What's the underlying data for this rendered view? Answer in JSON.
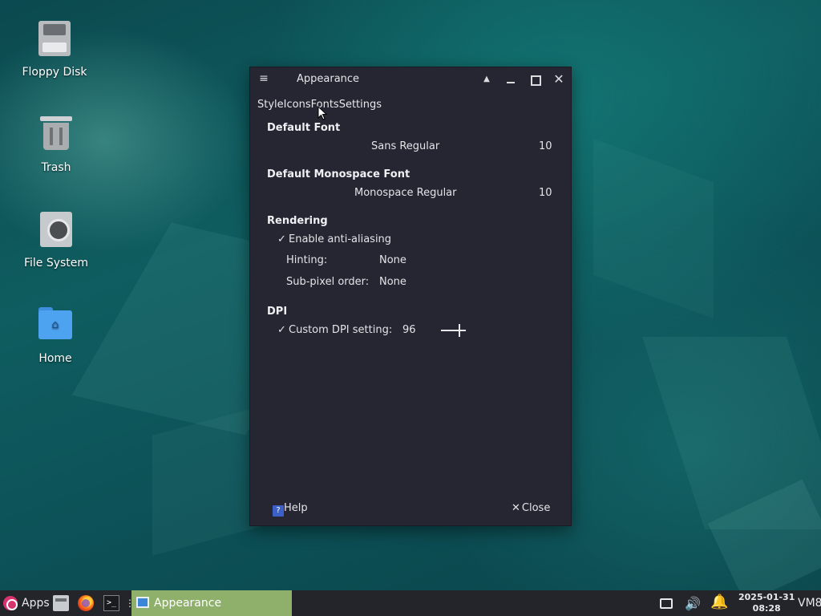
{
  "desktop": {
    "icons": [
      {
        "label": "Floppy Disk",
        "icon": "floppy-disk-icon"
      },
      {
        "label": "Trash",
        "icon": "trash-icon"
      },
      {
        "label": "File System",
        "icon": "hard-drive-icon"
      },
      {
        "label": "Home",
        "icon": "home-folder-icon"
      }
    ]
  },
  "window": {
    "title": "Appearance",
    "menu_glyph": "≡",
    "controls": {
      "shade": "▲",
      "close": "✕"
    },
    "tabs": [
      "Style",
      "Icons",
      "Fonts",
      "Settings"
    ],
    "default_font": {
      "heading": "Default Font",
      "name": "Sans Regular",
      "size": "10"
    },
    "monospace_font": {
      "heading": "Default Monospace Font",
      "name": "Monospace Regular",
      "size": "10"
    },
    "rendering": {
      "heading": "Rendering",
      "antialias_check": "✓",
      "antialias_label": "Enable anti-aliasing",
      "hinting_label": "Hinting:",
      "hinting_value": "None",
      "subpixel_label": "Sub-pixel order:",
      "subpixel_value": "None"
    },
    "dpi": {
      "heading": "DPI",
      "custom_check": "✓",
      "custom_label": "Custom DPI setting:",
      "value": "96"
    },
    "buttons": {
      "help_glyph": "?",
      "help": "Help",
      "close_glyph": "✕",
      "close": "Close"
    }
  },
  "taskbar": {
    "apps_label": "Apps",
    "launchers": [
      "file-manager-icon",
      "firefox-icon",
      "terminal-icon"
    ],
    "terminal_glyph": ">_",
    "more_glyph": "⋮",
    "active_task": "Appearance",
    "tray": {
      "volume_glyph": "🔊",
      "bell_glyph": "🔔"
    },
    "date": "2025-01-31",
    "time": "08:28",
    "user_label": "VM8"
  },
  "colors": {
    "window_bg": "#252632",
    "taskbar_bg": "#24252b",
    "active_task_bg": "#8fb06a",
    "desktop_accent": "#0f5d60"
  }
}
